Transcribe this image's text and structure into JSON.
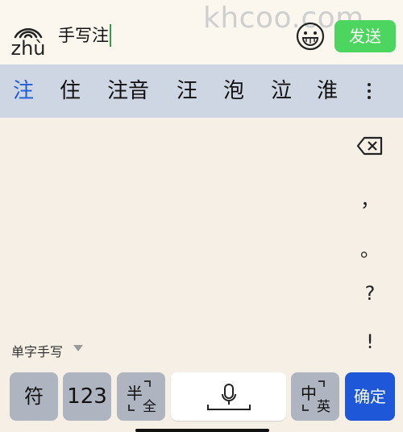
{
  "watermark": "khcoo.com",
  "topbar": {
    "pinyin_label": "zhù",
    "input_text": "手写注",
    "emoji_icon": "smiley-face-icon",
    "send_label": "发送",
    "send_color": "#4cd660"
  },
  "candidates": {
    "items": [
      "注",
      "住",
      "注音",
      "汪",
      "泡",
      "泣",
      "淮"
    ],
    "more_icon": "vertical-ellipsis-icon",
    "bar_color": "#cfd6e3",
    "active_color": "#1f5fd6"
  },
  "handwriting": {
    "backspace_icon": "backspace-icon",
    "punctuation": [
      "，",
      "。",
      "?",
      "!"
    ],
    "mode_label": "单字手写",
    "mode_arrow_icon": "triangle-down-icon"
  },
  "keyboard": {
    "symbol_label": "符",
    "numeric_label": "123",
    "half_full_main": "半",
    "half_full_sub": "全",
    "voice_icon": "microphone-icon",
    "zh_en_main": "中",
    "zh_en_sub": "英",
    "confirm_label": "确定",
    "confirm_color": "#1e57d8"
  }
}
